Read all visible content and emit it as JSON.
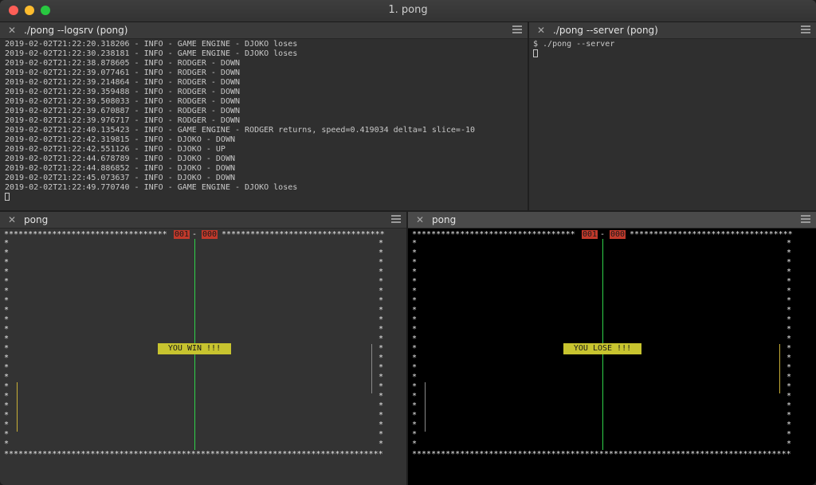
{
  "window": {
    "title": "1. pong"
  },
  "panes": {
    "logsrv": {
      "title": "./pong --logsrv (pong)",
      "lines": [
        "2019-02-02T21:22:20.318206 - INFO - GAME ENGINE - DJOKO loses",
        "2019-02-02T21:22:30.238181 - INFO - GAME ENGINE - DJOKO loses",
        "2019-02-02T21:22:38.878605 - INFO - RODGER - DOWN",
        "2019-02-02T21:22:39.077461 - INFO - RODGER - DOWN",
        "2019-02-02T21:22:39.214864 - INFO - RODGER - DOWN",
        "2019-02-02T21:22:39.359488 - INFO - RODGER - DOWN",
        "2019-02-02T21:22:39.508033 - INFO - RODGER - DOWN",
        "2019-02-02T21:22:39.670887 - INFO - RODGER - DOWN",
        "2019-02-02T21:22:39.976717 - INFO - RODGER - DOWN",
        "2019-02-02T21:22:40.135423 - INFO - GAME ENGINE - RODGER returns, speed=0.419034 delta=1 slice=-10",
        "2019-02-02T21:22:42.319815 - INFO - DJOKO - DOWN",
        "2019-02-02T21:22:42.551126 - INFO - DJOKO - UP",
        "2019-02-02T21:22:44.678789 - INFO - DJOKO - DOWN",
        "2019-02-02T21:22:44.886852 - INFO - DJOKO - DOWN",
        "2019-02-02T21:22:45.073637 - INFO - DJOKO - DOWN",
        "2019-02-02T21:22:49.770740 - INFO - GAME ENGINE - DJOKO loses"
      ]
    },
    "server": {
      "title": "./pong --server (pong)",
      "prompt": "$ ./pong --server"
    },
    "pong_left": {
      "title": "pong",
      "score_left": "001",
      "score_sep": "-",
      "score_right": "000",
      "message": "YOU WIN !!!",
      "bg": "#333333",
      "paddle_color_left": "#c9b037",
      "paddle_color_right": "#8a8a8a"
    },
    "pong_right": {
      "title": "pong",
      "score_left": "001",
      "score_sep": "-",
      "score_right": "000",
      "message": "YOU LOSE !!!",
      "bg": "#000000",
      "paddle_color_left": "#8a8a8a",
      "paddle_color_right": "#c9b037"
    }
  },
  "colors": {
    "net": "#2fd34a",
    "score_bg": "#c0392b",
    "banner_bg": "#c8c42f"
  }
}
